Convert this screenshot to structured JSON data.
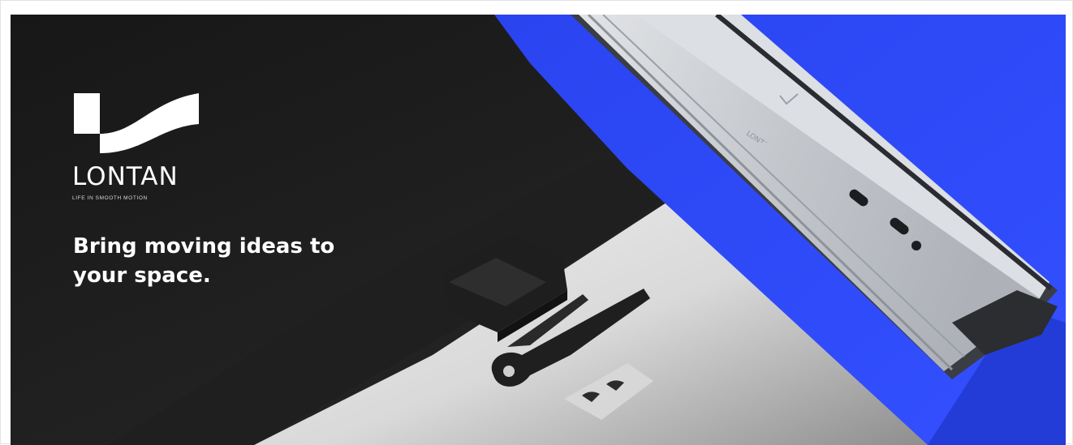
{
  "brand": {
    "name": "LONTAN",
    "tagline": "LIFE IN SMOOTH MOTION",
    "rail_engraving": "LONTAN"
  },
  "hero": {
    "headline": "Bring moving ideas to your space."
  },
  "colors": {
    "dark_panel": "#1a1a1a",
    "accent_blue": "#2e4bff",
    "rail_steel": "#c9ccd1",
    "light_surface": "#e6e6e6",
    "part_black": "#202020"
  },
  "icons": {
    "logo": "lontan-logo-icon"
  }
}
